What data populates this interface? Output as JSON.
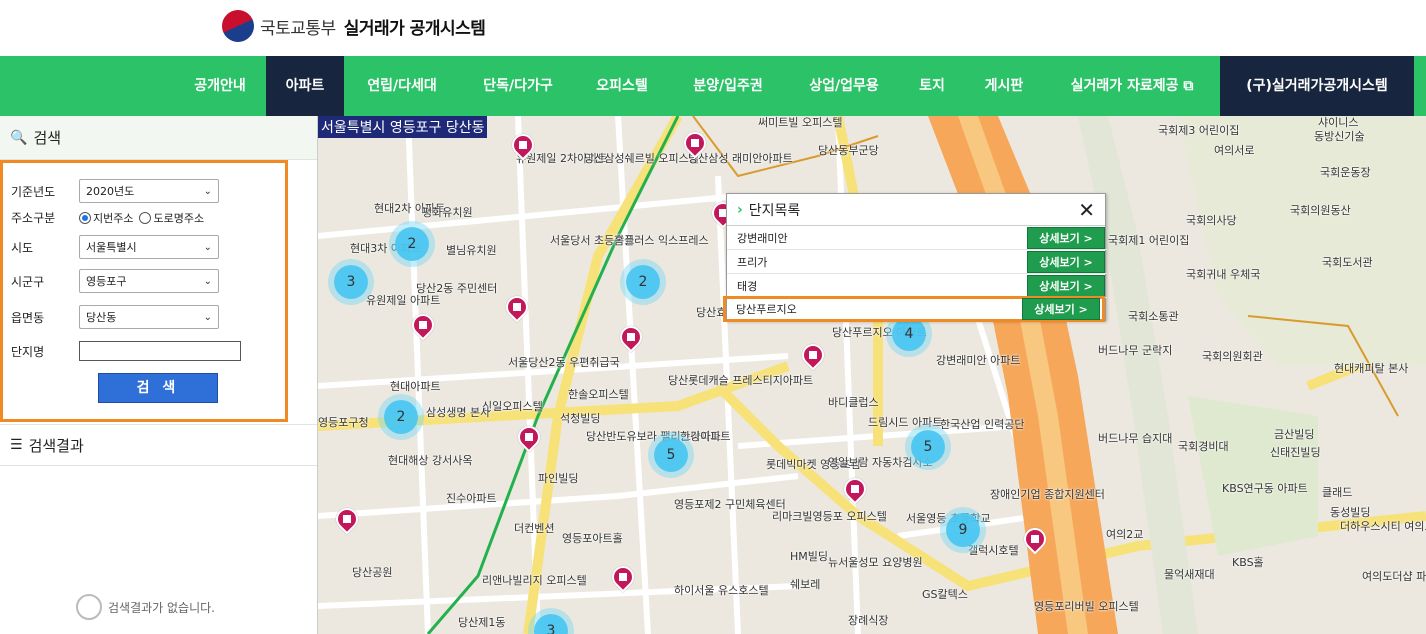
{
  "header": {
    "ministry": "국토교통부",
    "system_title": "실거래가 공개시스템"
  },
  "nav": {
    "items": [
      "공개안내",
      "아파트",
      "연립/다세대",
      "단독/다가구",
      "오피스텔",
      "분양/입주권",
      "상업/업무용",
      "토지",
      "게시판",
      "실거래가 자료제공 ⧉",
      "(구)실거래가공개시스템"
    ],
    "active_index": 1
  },
  "search": {
    "title": "검색",
    "year_label": "기준년도",
    "year_value": "2020년도",
    "addr_type_label": "주소구분",
    "addr_options": [
      "지번주소",
      "도로명주소"
    ],
    "addr_selected": "지번주소",
    "sido_label": "시도",
    "sido_value": "서울특별시",
    "sigungu_label": "시군구",
    "sigungu_value": "영등포구",
    "dong_label": "읍면동",
    "dong_value": "당산동",
    "complex_label": "단지명",
    "complex_value": "",
    "button": "검 색"
  },
  "results": {
    "title": "검색결과",
    "empty_text": "검색결과가 없습니다."
  },
  "map": {
    "region": "서울특별시 영등포구 당산동",
    "clusters": [
      "2",
      "3",
      "2",
      "2",
      "4",
      "5",
      "5",
      "9",
      "3"
    ],
    "labels": [
      "유원제일 2차아파트",
      "당산삼성쉐르빌 오피스텔",
      "당산삼성 래미안아파트",
      "써미트빌 오피스텔",
      "당산동부군당",
      "현대2차 아파트",
      "평화유치원",
      "현대3차 아파트",
      "별님유치원",
      "서울당서 초등학교",
      "홈플러스 익스프레스",
      "당산2동 주민센터",
      "유원제일 아파트",
      "당산효성",
      "당산푸르지오 아파트",
      "강변래미안 아파트",
      "현대아파트",
      "서울당산2동 우편취급국",
      "한솔오피스텔",
      "신일오피스텔",
      "석청빌딩",
      "당산롯데캐슬 프레스티지아파트",
      "바디클럽스",
      "드림시드 아파트",
      "한국산업 인력공단",
      "삼성생명 본사",
      "당산반도유보라 팰리스아파트",
      "한강아파트",
      "롯데빅마켓 영등포점",
      "영일보람 자동차검사소",
      "현대해상 강서사옥",
      "파인빌딩",
      "진수아파트",
      "영등포제2 구민체육센터",
      "리마크빌영등포 오피스텔",
      "장애인기업 종합지원센터",
      "더컨벤션",
      "영등포아트홀",
      "서울영등 초등학교",
      "갤럭시호텔",
      "영등포구청",
      "당산공원",
      "리앤나빌리지 오피스텔",
      "하이서울 유스호스텔",
      "HM빌딩",
      "뉴서울성모 요양병원",
      "쉐보레",
      "GS칼텍스",
      "영등포리버빌 오피스텔",
      "장례식장",
      "당산제1동",
      "국회의사당",
      "국회의원동산",
      "국회제1 어린이집",
      "국회제3 어린이집",
      "여의서로",
      "국회운동장",
      "국회도서관",
      "국회귀내 우체국",
      "국회소통관",
      "국회의원회관",
      "버드나무 군락지",
      "버드나무 습지대",
      "국회경비대",
      "현대캐피탈 본사",
      "금산빌딩",
      "신태진빌딩",
      "KBS연구동 아파트",
      "클래드",
      "동성빌딩",
      "더하우스시티 여의도오피스텔",
      "여의도더샵 파크센터",
      "물억새재대",
      "KBS홀",
      "여의2교",
      "동방신기술",
      "샤이니스"
    ],
    "popup": {
      "title": "단지목록",
      "items": [
        "강변래미안",
        "프리가",
        "태경",
        "당산푸르지오"
      ],
      "detail_label": "상세보기 >",
      "highlighted_index": 3
    }
  }
}
